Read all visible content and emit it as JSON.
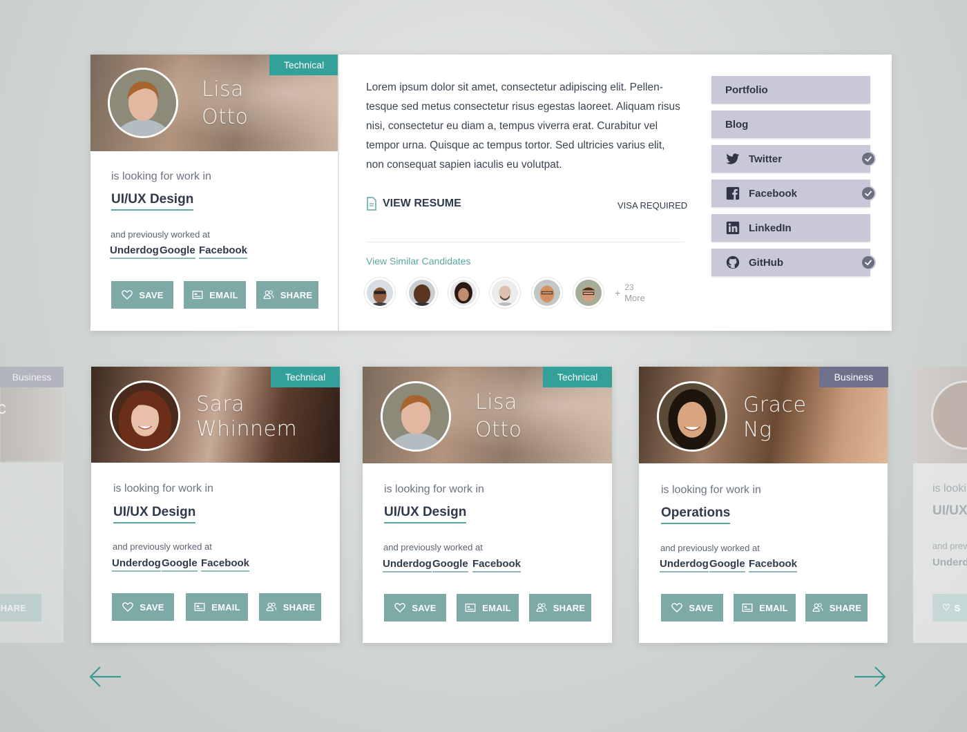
{
  "featured": {
    "tag": "Technical",
    "first_name": "Lisa",
    "last_name": "Otto",
    "looking_label": "is looking for work in",
    "field": "UI/UX Design",
    "prev_label": "and previously worked at",
    "companies": [
      "Underdog",
      "Google",
      "Facebook"
    ],
    "bio": "Lorem ipsum dolor sit amet, consectetur adipiscing elit. Pellen-\ntesque sed metus consectetur risus egestas laoreet. Aliquam risus\nnisi, consectetur eu diam a, tempus viverra erat. Curabitur vel\ntempor urna. Quisque ac tempus tortor. Sed ultricies varius elit,\nnon consequat sapien iaculis eu volutpat.",
    "view_resume": "VIEW RESUME",
    "visa": "VISA REQUIRED",
    "similar_label": "View Similar Candidates",
    "more_count": "23",
    "more_label": "More",
    "links": [
      {
        "label": "Portfolio",
        "icon": "none",
        "checked": false
      },
      {
        "label": "Blog",
        "icon": "none",
        "checked": false
      },
      {
        "label": "Twitter",
        "icon": "twitter-icon",
        "checked": true
      },
      {
        "label": "Facebook",
        "icon": "facebook-icon",
        "checked": true
      },
      {
        "label": "LinkedIn",
        "icon": "linkedin-icon",
        "checked": false
      },
      {
        "label": "GitHub",
        "icon": "github-icon",
        "checked": true
      }
    ]
  },
  "buttons": {
    "save": "SAVE",
    "email": "EMAIL",
    "share": "SHARE"
  },
  "cards": [
    {
      "tag": "Technical",
      "first_name": "Sara",
      "last_name": "Whinnem",
      "looking_label": "is looking for work in",
      "field": "UI/UX Design",
      "prev_label": "and previously worked at",
      "companies": [
        "Underdog",
        "Google",
        "Facebook"
      ]
    },
    {
      "tag": "Technical",
      "first_name": "Lisa",
      "last_name": "Otto",
      "looking_label": "is looking for work in",
      "field": "UI/UX Design",
      "prev_label": "and previously worked at",
      "companies": [
        "Underdog",
        "Google",
        "Facebook"
      ]
    },
    {
      "tag": "Business",
      "first_name": "Grace",
      "last_name": "Ng",
      "looking_label": "is looking for work in",
      "field": "Operations",
      "prev_label": "and previously worked at",
      "companies": [
        "Underdog",
        "Google",
        "Facebook"
      ]
    }
  ],
  "ghost_left": {
    "tag": "Business",
    "share": "SHARE",
    "name_fragment": "c"
  },
  "ghost_right": {
    "looking_fragment": "is lookin",
    "field_fragment": "UI/UX",
    "prev_fragment": "and prev",
    "company_fragment": "Underd",
    "btn_fragment": "S"
  },
  "colors": {
    "teal": "#33a09a",
    "button": "#7daaa6",
    "business": "#70708c",
    "link_bg": "#c8c8d9"
  }
}
